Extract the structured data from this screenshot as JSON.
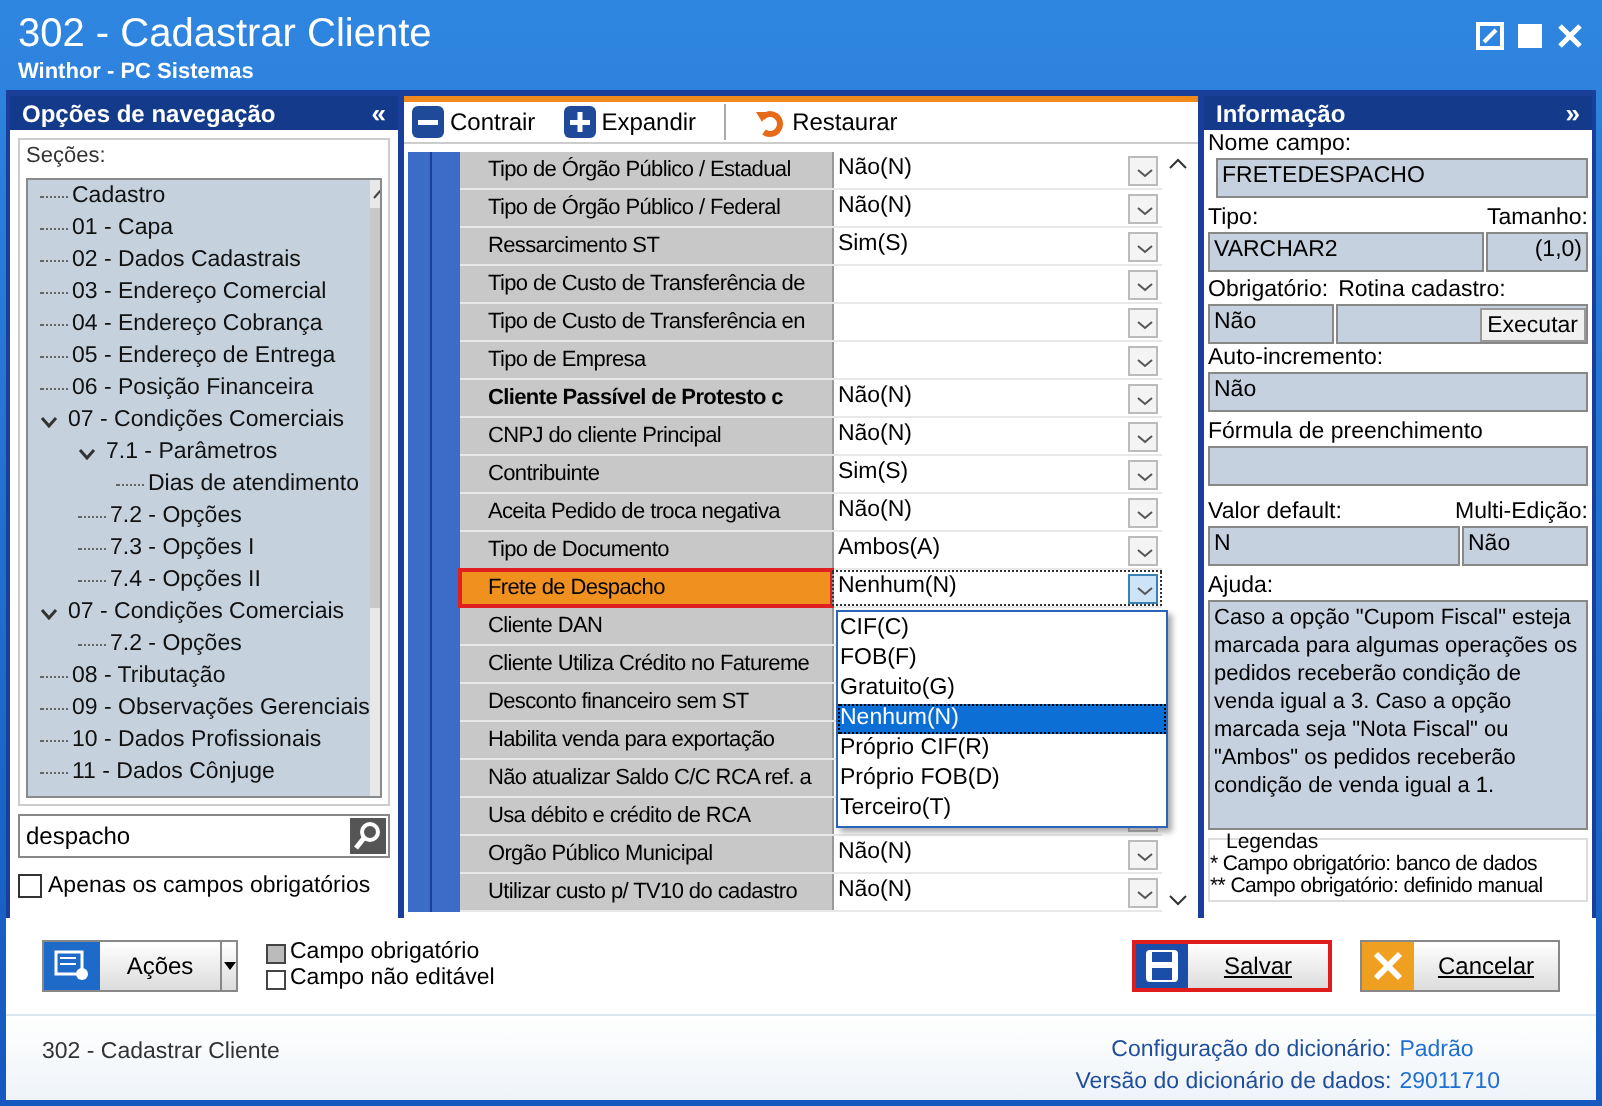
{
  "window": {
    "title": "302 - Cadastrar Cliente",
    "subtitle": "Winthor - PC Sistemas"
  },
  "nav": {
    "title": "Opções de navegação",
    "collapse": "«",
    "sections_label": "Seções:",
    "tree": [
      {
        "label": "Cadastro"
      },
      {
        "label": "01 - Capa"
      },
      {
        "label": "02 - Dados Cadastrais"
      },
      {
        "label": "03 - Endereço Comercial"
      },
      {
        "label": "04 - Endereço Cobrança"
      },
      {
        "label": "05 - Endereço de Entrega"
      },
      {
        "label": "06 - Posição Financeira"
      },
      {
        "label": "07 - Condições Comerciais",
        "expanded": true,
        "children": [
          {
            "label": "7.1 - Parâmetros",
            "expanded": true,
            "children": [
              {
                "label": "Dias de atendimento"
              }
            ]
          },
          {
            "label": "7.2 - Opções"
          },
          {
            "label": "7.3 - Opções I"
          },
          {
            "label": "7.4 - Opções II"
          }
        ]
      },
      {
        "label": "07 - Condições Comerciais",
        "expanded": true,
        "children": [
          {
            "label": "7.2 - Opções"
          }
        ]
      },
      {
        "label": "08 - Tributação"
      },
      {
        "label": "09 - Observações Gerenciais"
      },
      {
        "label": "10 - Dados Profissionais"
      },
      {
        "label": "11 - Dados Cônjuge"
      }
    ],
    "search": {
      "value": "despacho"
    },
    "only_required": {
      "label": "Apenas os campos obrigatórios",
      "checked": false
    }
  },
  "toolbar": [
    {
      "kind": "collapse",
      "label": "Contrair"
    },
    {
      "kind": "expand",
      "label": "Expandir"
    },
    {
      "kind": "restore",
      "label": "Restaurar"
    }
  ],
  "grid": {
    "rows": [
      {
        "label": "Tipo de Órgão Público / Estadual",
        "value": "Não(N)",
        "bold": false,
        "selected": false
      },
      {
        "label": "Tipo de Órgão Público / Federal",
        "value": "Não(N)",
        "bold": false,
        "selected": false
      },
      {
        "label": "Ressarcimento ST",
        "value": "Sim(S)",
        "bold": false,
        "selected": false
      },
      {
        "label": "Tipo de Custo de Transferência de",
        "bold": false,
        "selected": false
      },
      {
        "label": "Tipo de Custo de Transferência en",
        "bold": false,
        "selected": false
      },
      {
        "label": "Tipo de Empresa",
        "bold": false,
        "selected": false
      },
      {
        "label": "Cliente Passível de Protesto c",
        "value": "Não(N)",
        "bold": true,
        "selected": false
      },
      {
        "label": "CNPJ do cliente Principal",
        "value": "Não(N)",
        "bold": false,
        "selected": false
      },
      {
        "label": "Contribuinte",
        "value": "Sim(S)",
        "bold": false,
        "selected": false
      },
      {
        "label": "Aceita Pedido de troca negativa",
        "value": "Não(N)",
        "bold": false,
        "selected": false
      },
      {
        "label": "Tipo de Documento",
        "value": "Ambos(A)",
        "bold": false,
        "selected": false
      },
      {
        "label": "Frete de Despacho",
        "value": "Nenhum(N)",
        "bold": false,
        "selected": true
      },
      {
        "label": "Cliente DAN",
        "bold": false,
        "selected": false
      },
      {
        "label": "Cliente Utiliza Crédito no Fatureme",
        "bold": false,
        "selected": false
      },
      {
        "label": "Desconto financeiro sem ST",
        "bold": false,
        "selected": false
      },
      {
        "label": "Habilita venda para exportação",
        "bold": false,
        "selected": false
      },
      {
        "label": "Não atualizar Saldo C/C RCA ref. a",
        "bold": false,
        "selected": false
      },
      {
        "label": "Usa débito e crédito de RCA",
        "bold": false,
        "selected": false
      },
      {
        "label": "Orgão Público Municipal",
        "value": "Não(N)",
        "bold": false,
        "selected": false
      },
      {
        "label": "Utilizar custo p/ TV10 do cadastro",
        "value": "Não(N)",
        "bold": false,
        "selected": false
      }
    ],
    "dropdown": [
      {
        "label": "CIF(C)",
        "selected": false
      },
      {
        "label": "FOB(F)",
        "selected": false
      },
      {
        "label": "Gratuito(G)",
        "selected": false
      },
      {
        "label": "Nenhum(N)",
        "selected": true
      },
      {
        "label": "Próprio CIF(R)",
        "selected": false
      },
      {
        "label": "Próprio FOB(D)",
        "selected": false
      },
      {
        "label": "Terceiro(T)",
        "selected": false
      }
    ]
  },
  "info": {
    "title": "Informação",
    "collapse": "»",
    "field_name_label": "Nome campo:",
    "field_name": "FRETEDESPACHO",
    "type_label": "Tipo:",
    "type": "VARCHAR2",
    "size_label": "Tamanho:",
    "size": "(1,0)",
    "required_label": "Obrigatório:",
    "required": "Não",
    "routine_label": "Rotina cadastro:",
    "execute": "Executar",
    "auto_label": "Auto-incremento:",
    "auto": "Não",
    "formula_label": "Fórmula de preenchimento",
    "default_label": "Valor default:",
    "default": "N",
    "multi_label": "Multi-Edição:",
    "multi": "Não",
    "help_label": "Ajuda:",
    "help": "Caso a opção \"Cupom Fiscal\" esteja marcada para algumas operações os pedidos receberão condição de venda igual a 3. Caso a opção marcada seja \"Nota Fiscal\" ou \"Ambos\" os pedidos receberão condição de venda igual a 1.",
    "legend_title": "Legendas",
    "legend": [
      "* Campo obrigatório: banco de dados",
      "** Campo obrigatório: definido manual"
    ]
  },
  "actions": {
    "label": "Ações",
    "legend": [
      {
        "kind": "required",
        "label": "Campo obrigatório"
      },
      {
        "kind": "readonly",
        "label": "Campo não editável"
      }
    ],
    "save": "Salvar",
    "cancel": "Cancelar"
  },
  "status": {
    "routine": "302 - Cadastrar Cliente",
    "config_label": "Configuração do dicionário:",
    "config": "Padrão",
    "version_label": "Versão do dicionário de dados:",
    "version": "29011710"
  }
}
